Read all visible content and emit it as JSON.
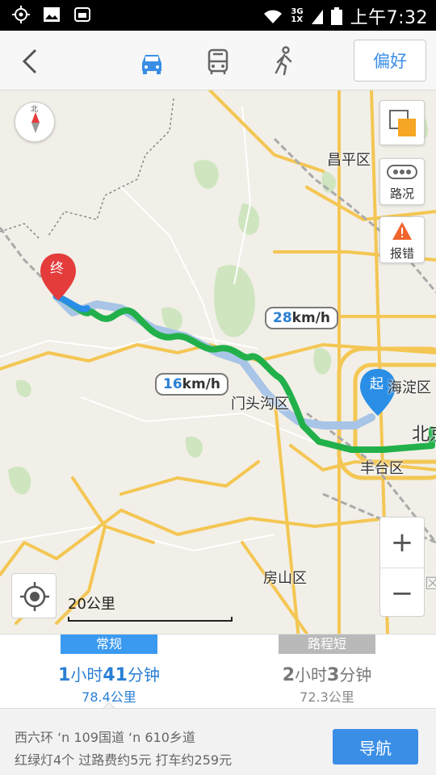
{
  "status_bar": {
    "network": "3G",
    "network2": "1X",
    "time": "上午7:32"
  },
  "topbar": {
    "modes": [
      "car-icon",
      "bus-icon",
      "walk-icon"
    ],
    "active_mode_color": "#3a8ee6",
    "preference_label": "偏好"
  },
  "map": {
    "districts": {
      "changping": "昌平区",
      "haidian": "海淀区",
      "beijing": "北京",
      "mentougou": "门头沟区",
      "fengtai": "丰台区",
      "fangshan": "房山区",
      "daxing": "大兴区"
    },
    "start_marker": "起",
    "end_marker": "终",
    "speed_labels": [
      {
        "value": "28",
        "unit": "km/h"
      },
      {
        "value": "16",
        "unit": "km/h"
      }
    ],
    "traffic_label": "路况",
    "report_label": "报错",
    "compass_label": "北",
    "zoom_in": "+",
    "zoom_out": "−",
    "scale_label": "20公里",
    "route_color": "#22b04a",
    "alt_route_color": "#a8c4e6"
  },
  "routes": [
    {
      "tag": "常规",
      "hours": "1",
      "h_unit": "小时",
      "minutes": "41",
      "m_unit": "分钟",
      "distance": "78.4公里",
      "active": true
    },
    {
      "tag": "路程短",
      "hours": "2",
      "h_unit": "小时",
      "minutes": "3",
      "m_unit": "分钟",
      "distance": "72.3公里",
      "active": false
    }
  ],
  "bottom": {
    "via": "西六环 ‘n 109国道 ‘n 610乡道",
    "info": "红绿灯4个  过路费约5元  打车约259元",
    "navigate_label": "导航"
  }
}
